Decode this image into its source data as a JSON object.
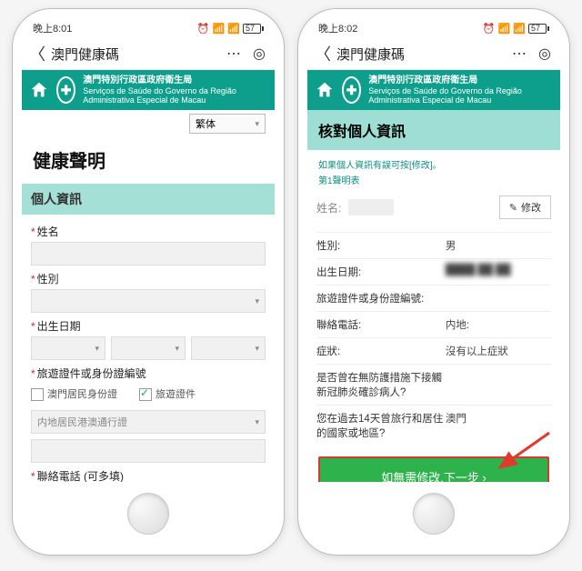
{
  "left": {
    "status_time": "晚上8:01",
    "nav_title": "澳門健康碼",
    "brand_zh": "澳門特別行政區政府衛生局",
    "brand_pt": "Serviços de Saúde do Governo da Região Administrativa Especial de Macau",
    "lang": "繁体",
    "page_title": "健康聲明",
    "section": "個人資訊",
    "labels": {
      "name": "姓名",
      "gender": "性別",
      "dob": "出生日期",
      "id": "旅遊證件或身份證編號",
      "phone": "聯絡電話 (可多填)"
    },
    "check_resident": "澳門居民身份證",
    "check_travel": "旅遊證件",
    "id_type_option": "内地居民港澳通行證"
  },
  "right": {
    "status_time": "晚上8:02",
    "nav_title": "澳門健康碼",
    "brand_zh": "澳門特別行政區政府衛生局",
    "brand_pt": "Serviços de Saúde do Governo da Região Administrativa Especial de Macau",
    "verify_title": "核對個人資訊",
    "hint1": "如果個人資訊有誤可按[修改]。",
    "hint2": "第1聲明表",
    "name_label": "姓名:",
    "edit_label": "修改",
    "rows": {
      "gender_k": "性別:",
      "gender_v": "男",
      "dob_k": "出生日期:",
      "dob_v": "",
      "id_k": "旅遊證件或身份證編號:",
      "id_v": "",
      "phone_k": "聯絡電話:",
      "phone_v": "内地:",
      "sym_k": "症狀:",
      "sym_v": "沒有以上症狀",
      "contact_k": "是否曾在無防護措施下接觸新冠肺炎確診病人?",
      "contact_v": "",
      "travel_k": "您在過去14天曾旅行和居住的國家或地區?",
      "travel_v": "澳門"
    },
    "button": "如無需修改,下一步 ›"
  },
  "battery": "57"
}
